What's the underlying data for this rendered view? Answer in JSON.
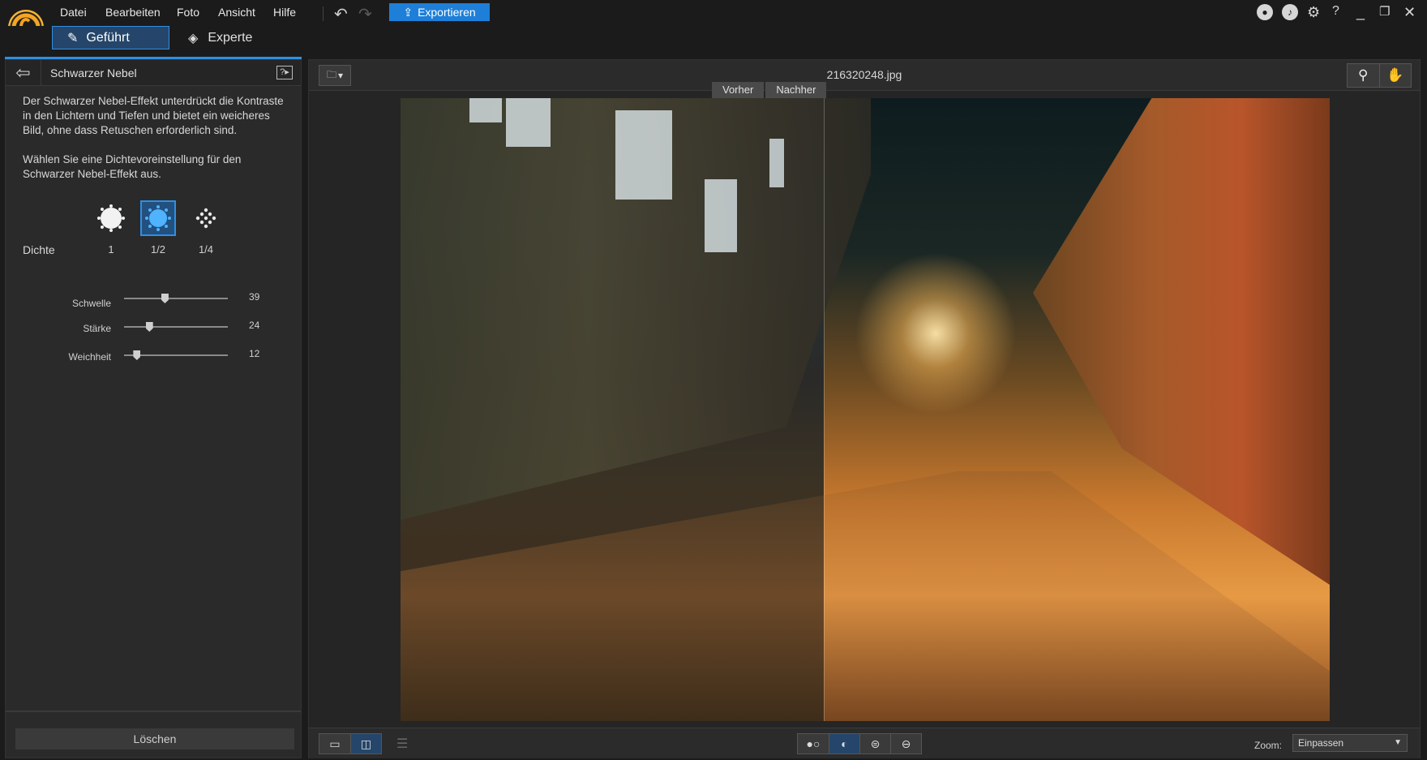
{
  "menu": {
    "items": [
      "Datei",
      "Bearbeiten",
      "Foto",
      "Ansicht",
      "Hilfe"
    ],
    "export_label": "Exportieren"
  },
  "modes": {
    "guided_label": "Geführt",
    "expert_label": "Experte"
  },
  "panel": {
    "title": "Schwarzer Nebel",
    "description": "Der Schwarzer Nebel-Effekt unterdrückt die Kontraste in den Lichtern und Tiefen und bietet ein weicheres Bild, ohne dass Retuschen erforderlich sind.",
    "instruction": "Wählen Sie eine Dichtevoreinstellung für den Schwarzer Nebel-Effekt aus.",
    "density_label": "Dichte",
    "presets": [
      {
        "label": "1",
        "selected": false
      },
      {
        "label": "1/2",
        "selected": true
      },
      {
        "label": "1/4",
        "selected": false
      }
    ],
    "sliders": [
      {
        "label": "Schwelle",
        "value": "39",
        "level": 0.39
      },
      {
        "label": "Stärke",
        "value": "24",
        "level": 0.24
      },
      {
        "label": "Weichheit",
        "value": "12",
        "level": 0.12
      }
    ],
    "delete_label": "Löschen"
  },
  "viewer": {
    "file_name": "216320248.jpg",
    "before_label": "Vorher",
    "after_label": "Nachher",
    "zoom_label": "Zoom:",
    "zoom_value": "Einpassen"
  },
  "colors": {
    "accent": "#2f8fe3",
    "export_button": "#1e7fd8",
    "background": "#1b1b1b",
    "panel": "#2a2a2a"
  },
  "icons": {
    "logo": "app-logo-icon",
    "undo": "undo-icon",
    "redo": "redo-icon",
    "export": "upload-icon",
    "account": "user-icon",
    "notifications": "bell-icon",
    "settings": "gear-icon",
    "help": "help-icon",
    "minimize": "minimize-icon",
    "restore": "restore-icon",
    "close": "close-icon",
    "guided": "magic-wand-icon",
    "expert": "layers-icon",
    "back": "arrow-left-icon",
    "panel_help": "help-panel-icon",
    "folder": "folder-icon",
    "zoom_tool": "magnifier-icon",
    "pan_tool": "hand-icon"
  }
}
